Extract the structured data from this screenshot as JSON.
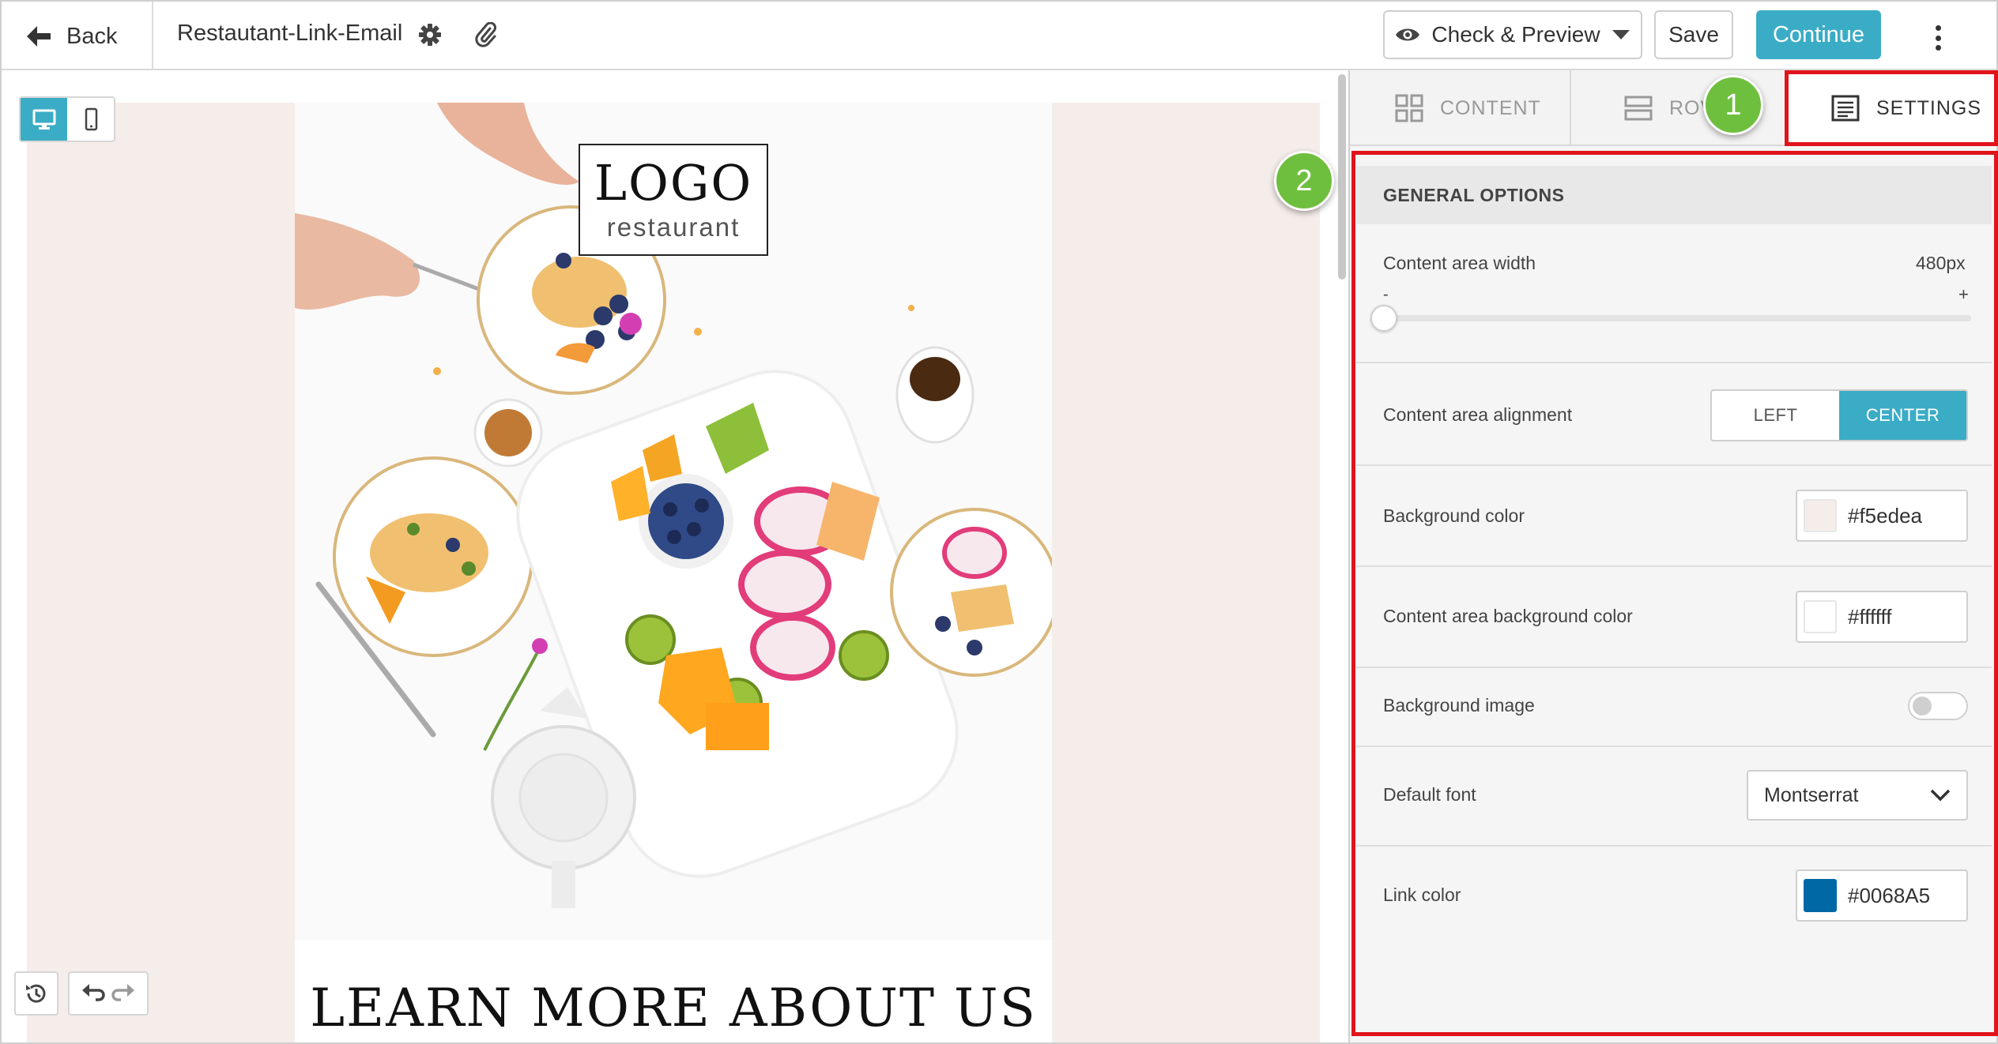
{
  "topbar": {
    "back_label": "Back",
    "document_title": "Restautant-Link-Email",
    "preview_label": "Check & Preview",
    "save_label": "Save",
    "continue_label": "Continue"
  },
  "email_preview": {
    "logo_main": "LOGO",
    "logo_sub": "restaurant",
    "headline": "LEARN MORE ABOUT US"
  },
  "panel": {
    "tabs": [
      {
        "label": "CONTENT",
        "icon": "grid-icon"
      },
      {
        "label": "ROWS",
        "icon": "rows-icon",
        "visible_text": "ROV"
      },
      {
        "label": "SETTINGS",
        "icon": "settings-list-icon"
      }
    ],
    "markers": [
      "1",
      "2"
    ],
    "section_title": "GENERAL OPTIONS",
    "options": {
      "content_width": {
        "label": "Content area width",
        "value": "480px",
        "min_label": "-",
        "max_label": "+"
      },
      "alignment": {
        "label": "Content area alignment",
        "options": [
          "LEFT",
          "CENTER"
        ],
        "selected": "CENTER"
      },
      "background_color": {
        "label": "Background color",
        "value": "#f5edea"
      },
      "content_bg_color": {
        "label": "Content area background color",
        "value": "#ffffff"
      },
      "background_image": {
        "label": "Background image",
        "enabled": false
      },
      "default_font": {
        "label": "Default font",
        "value": "Montserrat"
      },
      "link_color": {
        "label": "Link color",
        "value": "#0068A5"
      }
    }
  },
  "colors": {
    "accent": "#3bacc6",
    "highlight": "#e0141c",
    "marker": "#6fbf3f",
    "canvas_bg": "#f5edea",
    "link": "#0068A5"
  }
}
